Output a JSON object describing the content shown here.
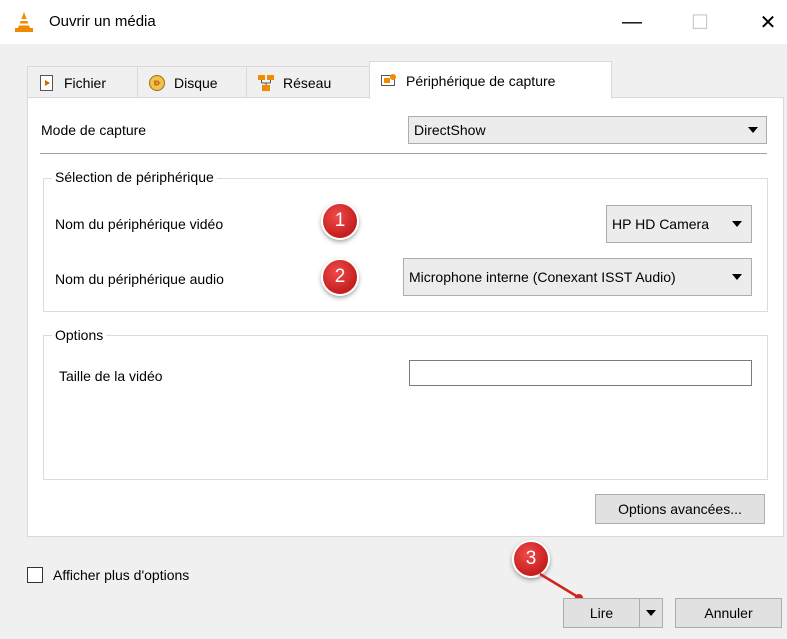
{
  "window": {
    "title": "Ouvrir un média",
    "controls": {
      "minimize": "—",
      "maximize": "☐",
      "close": "✕"
    }
  },
  "tabs": [
    {
      "label": "Fichier",
      "icon": "file-icon",
      "active": false
    },
    {
      "label": "Disque",
      "icon": "disc-icon",
      "active": false
    },
    {
      "label": "Réseau",
      "icon": "network-icon",
      "active": false
    },
    {
      "label": "Périphérique de capture",
      "icon": "capture-device-icon",
      "active": true
    }
  ],
  "capture": {
    "mode_label": "Mode de capture",
    "mode_value": "DirectShow"
  },
  "device_selection": {
    "title": "Sélection de périphérique",
    "video_label": "Nom du périphérique vidéo",
    "video_value": "HP HD Camera",
    "audio_label": "Nom du périphérique audio",
    "audio_value": "Microphone interne (Conexant ISST Audio)"
  },
  "options": {
    "title": "Options",
    "video_size_label": "Taille de la vidéo",
    "video_size_value": "",
    "advanced_button": "Options avancées..."
  },
  "footer": {
    "show_more_label": "Afficher plus d'options",
    "show_more_checked": false,
    "play_button": "Lire",
    "cancel_button": "Annuler"
  },
  "annotations": {
    "badge1": "1",
    "badge2": "2",
    "badge3": "3",
    "color": "#d32222"
  },
  "colors": {
    "accent_vlc": "#f08a00",
    "window_bg": "#f0f0f0",
    "panel_bg": "#ffffff"
  }
}
